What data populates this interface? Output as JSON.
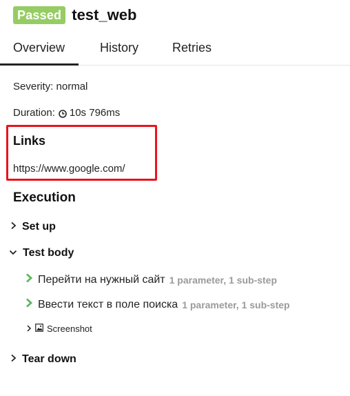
{
  "header": {
    "status_badge": "Passed",
    "title": "test_web",
    "colors": {
      "passed": "#97cc64",
      "highlight": "#e8141c",
      "step_chevron": "#5cb85c"
    }
  },
  "tabs": [
    {
      "label": "Overview",
      "active": true
    },
    {
      "label": "History",
      "active": false
    },
    {
      "label": "Retries",
      "active": false
    }
  ],
  "overview": {
    "severity_text": "Severity: normal",
    "duration_label": "Duration:",
    "duration_icon": "clock-icon",
    "duration_value": "10s 796ms",
    "links_title": "Links",
    "link_url": "https://www.google.com/",
    "execution_title": "Execution"
  },
  "execution": {
    "setup": {
      "label": "Set up",
      "expanded": false,
      "icon": "chevron-right-icon"
    },
    "test_body": {
      "label": "Test body",
      "expanded": true,
      "icon": "chevron-down-icon",
      "steps": [
        {
          "label": "Перейти на нужный сайт",
          "meta": "1 parameter, 1 sub-step",
          "icon": "chevron-right-icon"
        },
        {
          "label": "Ввести текст в поле поиска",
          "meta": "1 parameter, 1 sub-step",
          "icon": "chevron-right-icon"
        }
      ],
      "attachment": {
        "label": "Screenshot",
        "icon": "image-icon"
      }
    },
    "teardown": {
      "label": "Tear down",
      "expanded": false,
      "icon": "chevron-right-icon"
    }
  }
}
